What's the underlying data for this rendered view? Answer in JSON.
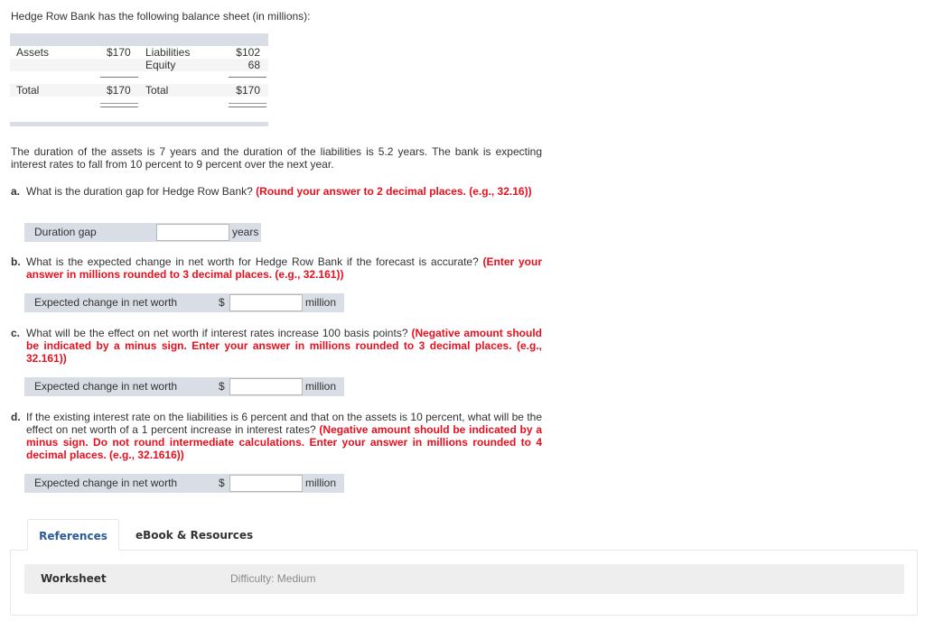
{
  "intro": "Hedge Row Bank has the following balance sheet (in millions):",
  "balance_sheet": {
    "rows": [
      {
        "left_label": "Assets",
        "left_value": "$170",
        "right_label": "Liabilities",
        "right_value": "$102"
      },
      {
        "left_label": "",
        "left_value": "",
        "right_label": "Equity",
        "right_value": "68"
      },
      {
        "left_label": "Total",
        "left_value": "$170",
        "right_label": "Total",
        "right_value": "$170"
      }
    ]
  },
  "description": "The duration of the assets is 7 years and the duration of the liabilities is 5.2 years. The bank is expecting interest rates to fall from 10 percent to 9 percent over the next year.",
  "questions": [
    {
      "letter": "a.",
      "text": "What is the duration gap for Hedge Row Bank?",
      "instruction": "(Round your answer to 2 decimal places. (e.g., 32.16))",
      "answer": {
        "label": "Duration gap",
        "prefix": "",
        "value": "",
        "unit": "years"
      }
    },
    {
      "letter": "b.",
      "text": "What is the expected change in net worth for Hedge Row Bank if the forecast is accurate?",
      "instruction": "(Enter your answer in millions rounded to 3 decimal places. (e.g., 32.161))",
      "answer": {
        "label": "Expected change in net worth",
        "prefix": "$",
        "value": "",
        "unit": "million"
      }
    },
    {
      "letter": "c.",
      "text": "What will be the effect on net worth if interest rates increase 100 basis points?",
      "instruction": "(Negative amount should be indicated by a minus sign. Enter your answer in millions rounded to 3 decimal places. (e.g., 32.161))",
      "answer": {
        "label": "Expected change in net worth",
        "prefix": "$",
        "value": "",
        "unit": "million"
      }
    },
    {
      "letter": "d.",
      "text": "If the existing interest rate on the liabilities is 6 percent and that on the assets is 10 percent, what will be the effect on net worth of a 1 percent increase in interest rates?",
      "instruction": "(Negative amount should be indicated by a minus sign. Do not round intermediate calculations. Enter your answer in millions rounded to 4 decimal places. (e.g., 32.1616))",
      "answer": {
        "label": "Expected change in net worth",
        "prefix": "$",
        "value": "",
        "unit": "million"
      }
    }
  ],
  "tabs": [
    {
      "label": "References",
      "active": true
    },
    {
      "label": "eBook & Resources",
      "active": false
    }
  ],
  "worksheet": {
    "label": "Worksheet",
    "difficulty": "Difficulty: Medium"
  },
  "colors": {
    "instruction_red": "#e8101e",
    "active_tab_blue": "#2c5a9a",
    "answer_row_bg": "#d9dde6"
  }
}
